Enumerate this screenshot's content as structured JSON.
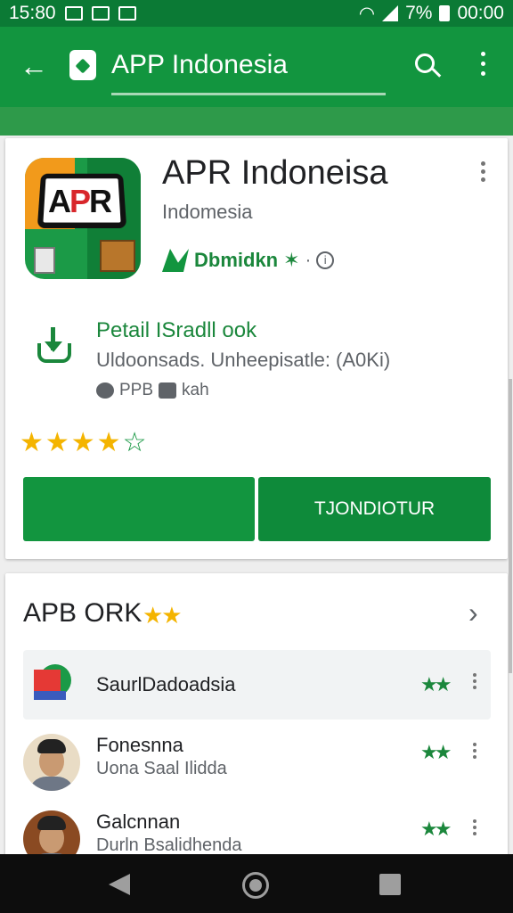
{
  "status_bar": {
    "time": "15:80",
    "battery": "7%",
    "clock_right": "00:00"
  },
  "app_bar": {
    "title": "APP Indonesia"
  },
  "app": {
    "name": "APR Indoneisa",
    "subtitle": "Indomesia",
    "developer": "Dbmidkn",
    "icon_text_black": "A",
    "icon_text_red": "P",
    "icon_text_black2": "R"
  },
  "download": {
    "title": "Petail ISradll ook",
    "description": "Uldoonsads. Unheepisatle: (A0Ki)",
    "meta_1": "PPB",
    "meta_2": "kah"
  },
  "rating": {
    "value": 4,
    "max": 5
  },
  "buttons": {
    "left_label": "",
    "right_label": "TJONDIOTUR"
  },
  "list": {
    "title": "APB ORK",
    "items": [
      {
        "name": "SaurlDadoadsia",
        "subtitle": ""
      },
      {
        "name": "Fonesnna",
        "subtitle": "Uona Saal Ilidda"
      },
      {
        "name": "Galcnnan",
        "subtitle": "Durln Bsalidhenda"
      }
    ]
  },
  "colors": {
    "primary_green": "#12953f",
    "dark_green": "#0b7a35",
    "star_yellow": "#f4b400"
  }
}
